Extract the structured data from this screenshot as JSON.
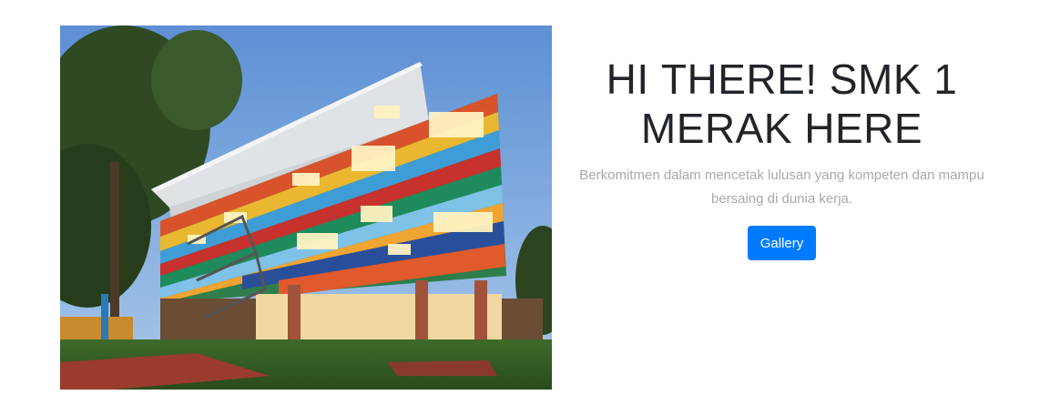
{
  "hero": {
    "image": {
      "alt": "Colorful school building"
    },
    "headline": {
      "part1": "HI ",
      "part2": "THERE!",
      "part3": " SMK 1",
      "part4": "MERAK ",
      "part5": "HERE"
    },
    "description": "Berkomitmen dalam mencetak lulusan yang kompeten dan mampu bersaing di dunia kerja.",
    "button_label": "Gallery"
  },
  "colors": {
    "primary": "#007bff",
    "heading": "#212529",
    "muted": "#a9a9a9"
  }
}
